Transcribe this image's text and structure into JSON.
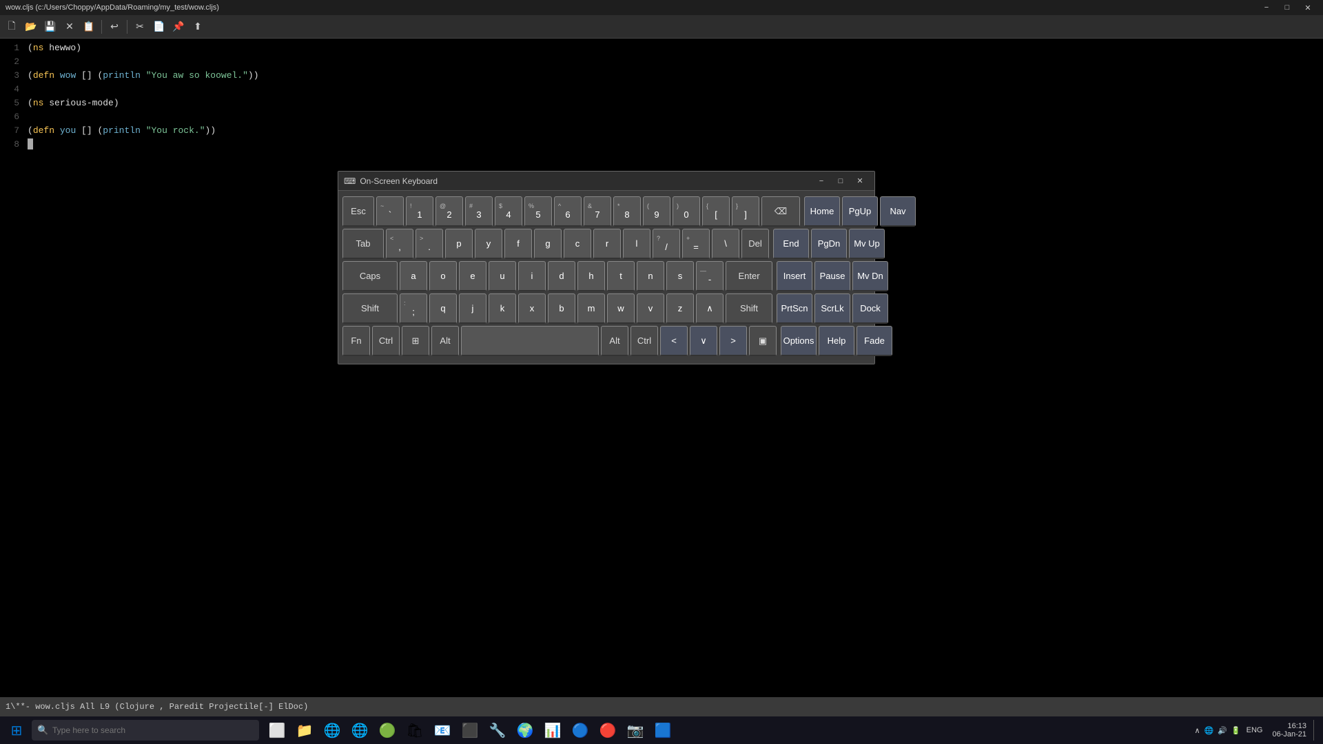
{
  "titlebar": {
    "text": "wow.cljs (c:/Users/Choppy/AppData/Roaming/my_test/wow.cljs)",
    "minimize": "−",
    "maximize": "□",
    "close": "✕"
  },
  "toolbar": {
    "buttons": [
      {
        "name": "new-file",
        "icon": "🗋"
      },
      {
        "name": "open-file",
        "icon": "📂"
      },
      {
        "name": "save-file",
        "icon": "💾"
      },
      {
        "name": "close-file",
        "icon": "✕"
      },
      {
        "name": "save-as",
        "icon": "📋"
      },
      {
        "name": "undo",
        "icon": "↩"
      },
      {
        "name": "cut",
        "icon": "✂"
      },
      {
        "name": "copy",
        "icon": "📄"
      },
      {
        "name": "paste",
        "icon": "📌"
      },
      {
        "name": "export",
        "icon": "⬆"
      }
    ]
  },
  "editor": {
    "lines": [
      {
        "num": "1",
        "content": "(ns hewwo)"
      },
      {
        "num": "2",
        "content": ""
      },
      {
        "num": "3",
        "content": "(defn wow [] (println \"You aw so koowel.\"))"
      },
      {
        "num": "4",
        "content": ""
      },
      {
        "num": "5",
        "content": "(ns serious-mode)"
      },
      {
        "num": "6",
        "content": ""
      },
      {
        "num": "7",
        "content": "(defn you [] (println \"You rock.\"))"
      },
      {
        "num": "8",
        "content": ""
      }
    ]
  },
  "statusbar": {
    "text": "1\\**-  wow.cljs     All L9     (Clojure , Paredit Projectile[-] ElDoc)"
  },
  "osk": {
    "title": "On-Screen Keyboard",
    "icon": "⌨",
    "minimize": "−",
    "maximize": "□",
    "close": "✕",
    "rows": [
      {
        "keys": [
          {
            "upper": "",
            "lower": "Esc",
            "type": "special"
          },
          {
            "upper": "~",
            "lower": "`",
            "type": "normal"
          },
          {
            "upper": "!",
            "lower": "1",
            "type": "normal"
          },
          {
            "upper": "@",
            "lower": "2",
            "type": "normal"
          },
          {
            "upper": "#",
            "lower": "3",
            "type": "normal"
          },
          {
            "upper": "$",
            "lower": "4",
            "type": "normal"
          },
          {
            "upper": "%",
            "lower": "5",
            "type": "normal"
          },
          {
            "upper": "^",
            "lower": "6",
            "type": "normal"
          },
          {
            "upper": "&",
            "lower": "7",
            "type": "normal"
          },
          {
            "upper": "*",
            "lower": "8",
            "type": "normal"
          },
          {
            "upper": "(",
            "lower": "9",
            "type": "normal"
          },
          {
            "upper": ")",
            "lower": "0",
            "type": "normal"
          },
          {
            "upper": "{",
            "lower": "[",
            "type": "normal"
          },
          {
            "upper": "}",
            "lower": "]",
            "type": "normal"
          },
          {
            "upper": "",
            "lower": "⌫",
            "type": "special backspace"
          },
          {
            "upper": "",
            "lower": "",
            "type": "divider"
          },
          {
            "upper": "",
            "lower": "Home",
            "type": "nav"
          },
          {
            "upper": "",
            "lower": "PgUp",
            "type": "nav"
          },
          {
            "upper": "",
            "lower": "Nav",
            "type": "nav"
          }
        ]
      },
      {
        "keys": [
          {
            "upper": "",
            "lower": "Tab",
            "type": "special wide"
          },
          {
            "upper": "<",
            "lower": ",",
            "type": "normal"
          },
          {
            "upper": ">",
            "lower": ".",
            "type": "normal"
          },
          {
            "upper": "",
            "lower": "p",
            "type": "normal"
          },
          {
            "upper": "",
            "lower": "y",
            "type": "normal"
          },
          {
            "upper": "",
            "lower": "f",
            "type": "normal"
          },
          {
            "upper": "",
            "lower": "g",
            "type": "normal"
          },
          {
            "upper": "",
            "lower": "c",
            "type": "normal"
          },
          {
            "upper": "",
            "lower": "r",
            "type": "normal"
          },
          {
            "upper": "",
            "lower": "l",
            "type": "normal"
          },
          {
            "upper": "?",
            "lower": "/",
            "type": "normal"
          },
          {
            "upper": "+",
            "lower": "=",
            "type": "normal"
          },
          {
            "upper": "",
            "lower": "\\",
            "type": "normal"
          },
          {
            "upper": "",
            "lower": "Del",
            "type": "special"
          },
          {
            "upper": "",
            "lower": "",
            "type": "divider"
          },
          {
            "upper": "",
            "lower": "End",
            "type": "nav"
          },
          {
            "upper": "",
            "lower": "PgDn",
            "type": "nav"
          },
          {
            "upper": "",
            "lower": "Mv Up",
            "type": "nav"
          }
        ]
      },
      {
        "keys": [
          {
            "upper": "",
            "lower": "Caps",
            "type": "special wide"
          },
          {
            "upper": "",
            "lower": "a",
            "type": "normal"
          },
          {
            "upper": "",
            "lower": "o",
            "type": "normal"
          },
          {
            "upper": "",
            "lower": "e",
            "type": "normal"
          },
          {
            "upper": "",
            "lower": "u",
            "type": "normal"
          },
          {
            "upper": "",
            "lower": "i",
            "type": "normal"
          },
          {
            "upper": "",
            "lower": "d",
            "type": "normal"
          },
          {
            "upper": "",
            "lower": "h",
            "type": "normal"
          },
          {
            "upper": "",
            "lower": "t",
            "type": "normal"
          },
          {
            "upper": "",
            "lower": "n",
            "type": "normal"
          },
          {
            "upper": "",
            "lower": "s",
            "type": "normal"
          },
          {
            "upper": "—",
            "lower": "-",
            "type": "normal"
          },
          {
            "upper": "",
            "lower": "Enter",
            "type": "special enter"
          },
          {
            "upper": "",
            "lower": "",
            "type": "divider"
          },
          {
            "upper": "",
            "lower": "Insert",
            "type": "nav"
          },
          {
            "upper": "",
            "lower": "Pause",
            "type": "nav"
          },
          {
            "upper": "",
            "lower": "Mv Dn",
            "type": "nav"
          }
        ]
      },
      {
        "keys": [
          {
            "upper": "",
            "lower": "Shift",
            "type": "special wide"
          },
          {
            "upper": ":",
            "lower": ";",
            "type": "normal"
          },
          {
            "upper": "",
            "lower": "q",
            "type": "normal"
          },
          {
            "upper": "",
            "lower": "j",
            "type": "normal"
          },
          {
            "upper": "",
            "lower": "k",
            "type": "normal"
          },
          {
            "upper": "",
            "lower": "x",
            "type": "normal"
          },
          {
            "upper": "",
            "lower": "b",
            "type": "normal"
          },
          {
            "upper": "",
            "lower": "m",
            "type": "normal"
          },
          {
            "upper": "",
            "lower": "w",
            "type": "normal"
          },
          {
            "upper": "",
            "lower": "v",
            "type": "normal"
          },
          {
            "upper": "",
            "lower": "z",
            "type": "normal"
          },
          {
            "upper": "",
            "lower": "∧",
            "type": "normal"
          },
          {
            "upper": "",
            "lower": "Shift",
            "type": "special shift-right"
          },
          {
            "upper": "",
            "lower": "",
            "type": "divider"
          },
          {
            "upper": "",
            "lower": "PrtScn",
            "type": "nav"
          },
          {
            "upper": "",
            "lower": "ScrLk",
            "type": "nav"
          },
          {
            "upper": "",
            "lower": "Dock",
            "type": "nav"
          }
        ]
      },
      {
        "keys": [
          {
            "upper": "",
            "lower": "Fn",
            "type": "special"
          },
          {
            "upper": "",
            "lower": "Ctrl",
            "type": "special"
          },
          {
            "upper": "",
            "lower": "⊞",
            "type": "special"
          },
          {
            "upper": "",
            "lower": "Alt",
            "type": "special"
          },
          {
            "upper": "",
            "lower": "",
            "type": "space"
          },
          {
            "upper": "",
            "lower": "Alt",
            "type": "special"
          },
          {
            "upper": "",
            "lower": "Ctrl",
            "type": "special"
          },
          {
            "upper": "",
            "lower": "<",
            "type": "arrow"
          },
          {
            "upper": "",
            "lower": "∨",
            "type": "arrow"
          },
          {
            "upper": "",
            "lower": ">",
            "type": "arrow"
          },
          {
            "upper": "",
            "lower": "▣",
            "type": "special"
          },
          {
            "upper": "",
            "lower": "",
            "type": "divider"
          },
          {
            "upper": "",
            "lower": "Options",
            "type": "nav"
          },
          {
            "upper": "",
            "lower": "Help",
            "type": "nav"
          },
          {
            "upper": "",
            "lower": "Fade",
            "type": "nav"
          }
        ]
      }
    ]
  },
  "taskbar": {
    "search_placeholder": "Type here to search",
    "apps": [
      {
        "name": "windows-icon",
        "icon": "⊞",
        "color": "#0078d7"
      },
      {
        "name": "search-icon",
        "icon": "🔍"
      },
      {
        "name": "task-view",
        "icon": "⬛"
      },
      {
        "name": "file-explorer",
        "icon": "📁"
      },
      {
        "name": "edge-browser",
        "icon": "🌐"
      },
      {
        "name": "ie-browser",
        "icon": "🌐"
      },
      {
        "name": "green-app",
        "icon": "🟢"
      },
      {
        "name": "store",
        "icon": "🛍"
      },
      {
        "name": "mail",
        "icon": "📧"
      },
      {
        "name": "terminal",
        "icon": "⬛"
      },
      {
        "name": "app10",
        "icon": "🔧"
      },
      {
        "name": "browser2",
        "icon": "🌍"
      },
      {
        "name": "visual-studio",
        "icon": "📊"
      },
      {
        "name": "clojure-app",
        "icon": "🔵"
      },
      {
        "name": "browser3",
        "icon": "🔴"
      },
      {
        "name": "photo-app",
        "icon": "📷"
      },
      {
        "name": "app17",
        "icon": "🟦"
      }
    ],
    "systray": {
      "lang": "ENG",
      "time": "16:13",
      "date": "06-Jan-21"
    }
  }
}
